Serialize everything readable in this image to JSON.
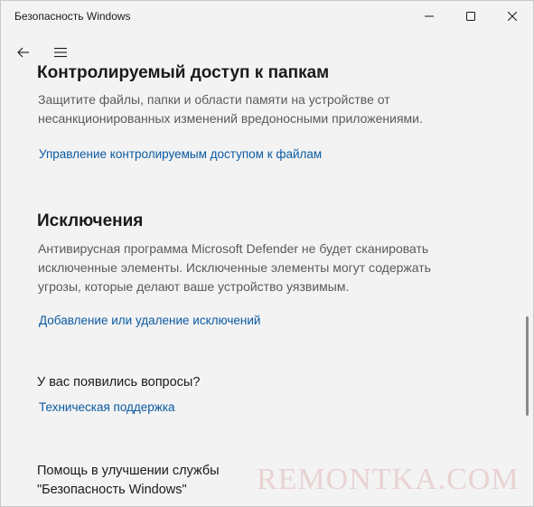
{
  "window": {
    "title": "Безопасность Windows"
  },
  "controlled_folder_access": {
    "heading": "Контролируемый доступ к папкам",
    "description_line1": "Защитите файлы, папки и области памяти на устройстве от",
    "description_line2": "несанкционированных изменений вредоносными приложениями.",
    "link": "Управление контролируемым доступом к файлам"
  },
  "exclusions": {
    "heading": "Исключения",
    "description_line1": "Антивирусная программа Microsoft Defender не будет сканировать",
    "description_line2": "исключенные элементы. Исключенные элементы могут содержать",
    "description_line3": "угрозы, которые делают ваше устройство уязвимым.",
    "link": "Добавление или удаление исключений"
  },
  "questions": {
    "heading": "У вас появились вопросы?",
    "link": "Техническая поддержка"
  },
  "help_improve": {
    "line1": "Помощь в улучшении службы",
    "line2": "\"Безопасность Windows\""
  },
  "watermark": "REMONTKA.COM",
  "colors": {
    "background": "#f3f3f3",
    "link": "#0b5aa2",
    "text": "#1a1a1a",
    "muted_text": "#5a5a5a"
  }
}
